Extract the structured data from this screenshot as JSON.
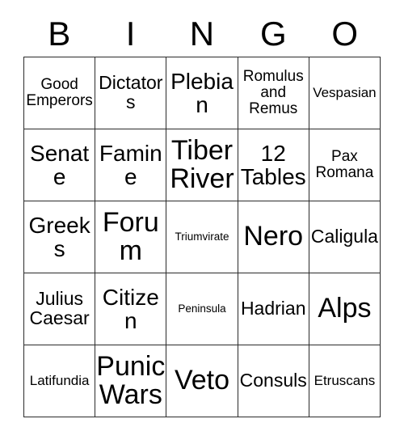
{
  "card": {
    "header_letters": [
      "B",
      "I",
      "N",
      "G",
      "O"
    ],
    "columns": 5,
    "rows": 5,
    "grid_line_color": "#2b2b2b",
    "background_color": "#ffffff",
    "text_color": "#000000",
    "cells": [
      [
        {
          "text": "Good Emperors",
          "size": "sm"
        },
        {
          "text": "Dictators",
          "size": "md"
        },
        {
          "text": "Plebian",
          "size": "lg"
        },
        {
          "text": "Romulus and Remus",
          "size": "sm"
        },
        {
          "text": "Vespasian",
          "size": "xs"
        }
      ],
      [
        {
          "text": "Senate",
          "size": "lg"
        },
        {
          "text": "Famine",
          "size": "lg"
        },
        {
          "text": "Tiber River",
          "size": "xl"
        },
        {
          "text": "12 Tables",
          "size": "lg"
        },
        {
          "text": "Pax Romana",
          "size": "sm"
        }
      ],
      [
        {
          "text": "Greeks",
          "size": "lg"
        },
        {
          "text": "Forum",
          "size": "xl"
        },
        {
          "text": "Triumvirate",
          "size": "xxs"
        },
        {
          "text": "Nero",
          "size": "xl"
        },
        {
          "text": "Caligula",
          "size": "md"
        }
      ],
      [
        {
          "text": "Julius Caesar",
          "size": "md"
        },
        {
          "text": "Citizen",
          "size": "lg"
        },
        {
          "text": "Peninsula",
          "size": "xxs"
        },
        {
          "text": "Hadrian",
          "size": "md"
        },
        {
          "text": "Alps",
          "size": "xl"
        }
      ],
      [
        {
          "text": "Latifundia",
          "size": "xs"
        },
        {
          "text": "Punic Wars",
          "size": "xl"
        },
        {
          "text": "Veto",
          "size": "xl"
        },
        {
          "text": "Consuls",
          "size": "md"
        },
        {
          "text": "Etruscans",
          "size": "xs"
        }
      ]
    ]
  }
}
